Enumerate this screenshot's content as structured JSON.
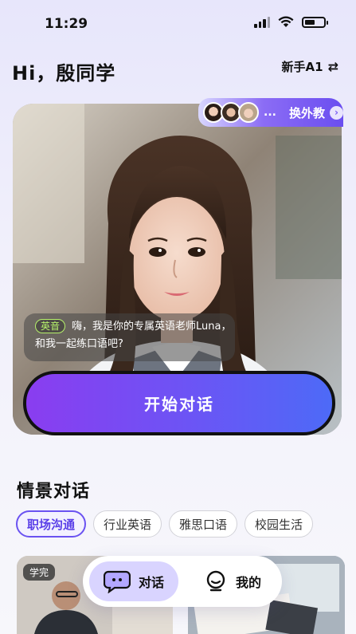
{
  "status_bar": {
    "time": "11:29"
  },
  "header": {
    "greeting": "Hi，殷同学",
    "level": "新手A1",
    "swap_icon": "⇄"
  },
  "teacher": {
    "switch_label": "换外教",
    "more": "...",
    "speech_tag": "英音",
    "speech_text": "嗨，我是你的专属英语老师Luna，和我一起练口语吧?",
    "start_label": "开始对话"
  },
  "scenarios": {
    "title": "情景对话",
    "chips": [
      "职场沟通",
      "行业英语",
      "雅思口语",
      "校园生活"
    ],
    "done_badge": "学完"
  },
  "bottom_nav": {
    "chat_label": "对话",
    "me_label": "我的"
  },
  "colors": {
    "accent": "#6a52f1",
    "button_start": "#8a3df0",
    "button_end": "#4d6af7",
    "tag_green": "#b6f16b"
  }
}
